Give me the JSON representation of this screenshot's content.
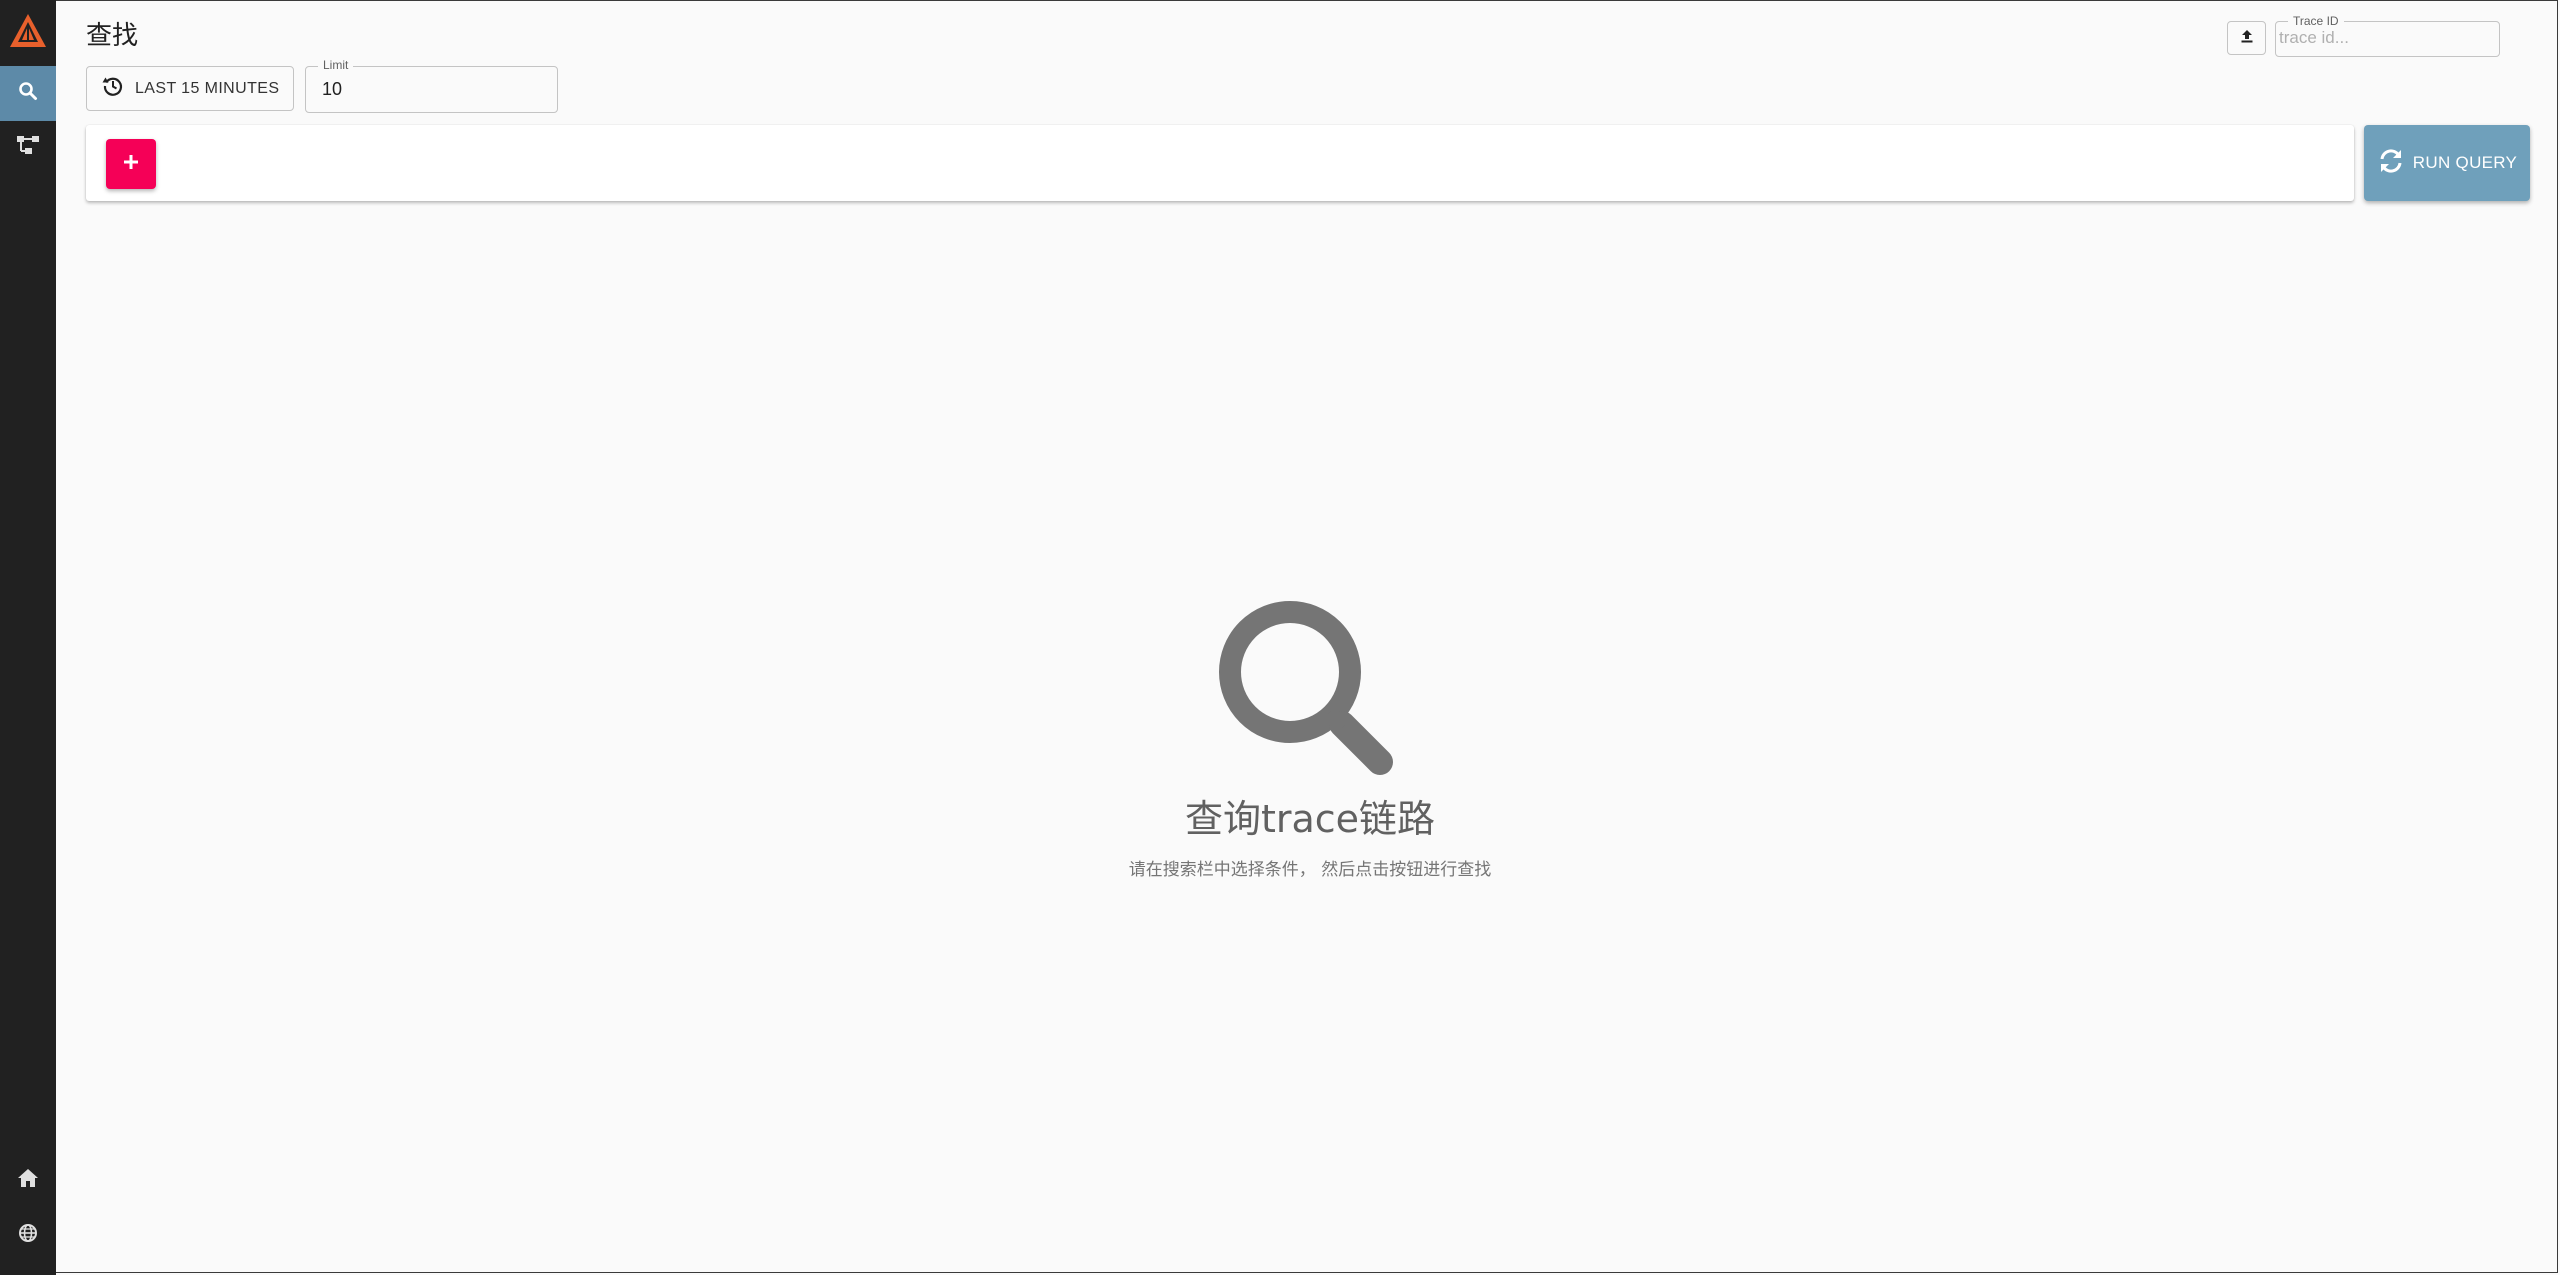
{
  "sidebar": {
    "logo_icon": "flame-logo-icon",
    "nav": [
      {
        "icon": "search-icon",
        "active": true
      },
      {
        "icon": "hierarchy-icon",
        "active": false
      },
      {
        "icon": "home-icon",
        "active": false
      },
      {
        "icon": "globe-icon",
        "active": false
      }
    ],
    "active_color": "#5d8aa8"
  },
  "header": {
    "title": "查找",
    "time_range_label": "LAST 15 MINUTES",
    "limit": {
      "label": "Limit",
      "value": "10"
    },
    "trace_id": {
      "label": "Trace ID",
      "placeholder": "trace id...",
      "value": ""
    }
  },
  "toolbar": {
    "add_button_color": "#f50057",
    "run_query_label": "RUN QUERY",
    "run_query_color": "#6fa0bb"
  },
  "empty_state": {
    "icon": "magnifier-icon",
    "title": "查询trace链路",
    "subtitle": "请在搜索栏中选择条件， 然后点击按钮进行查找"
  }
}
